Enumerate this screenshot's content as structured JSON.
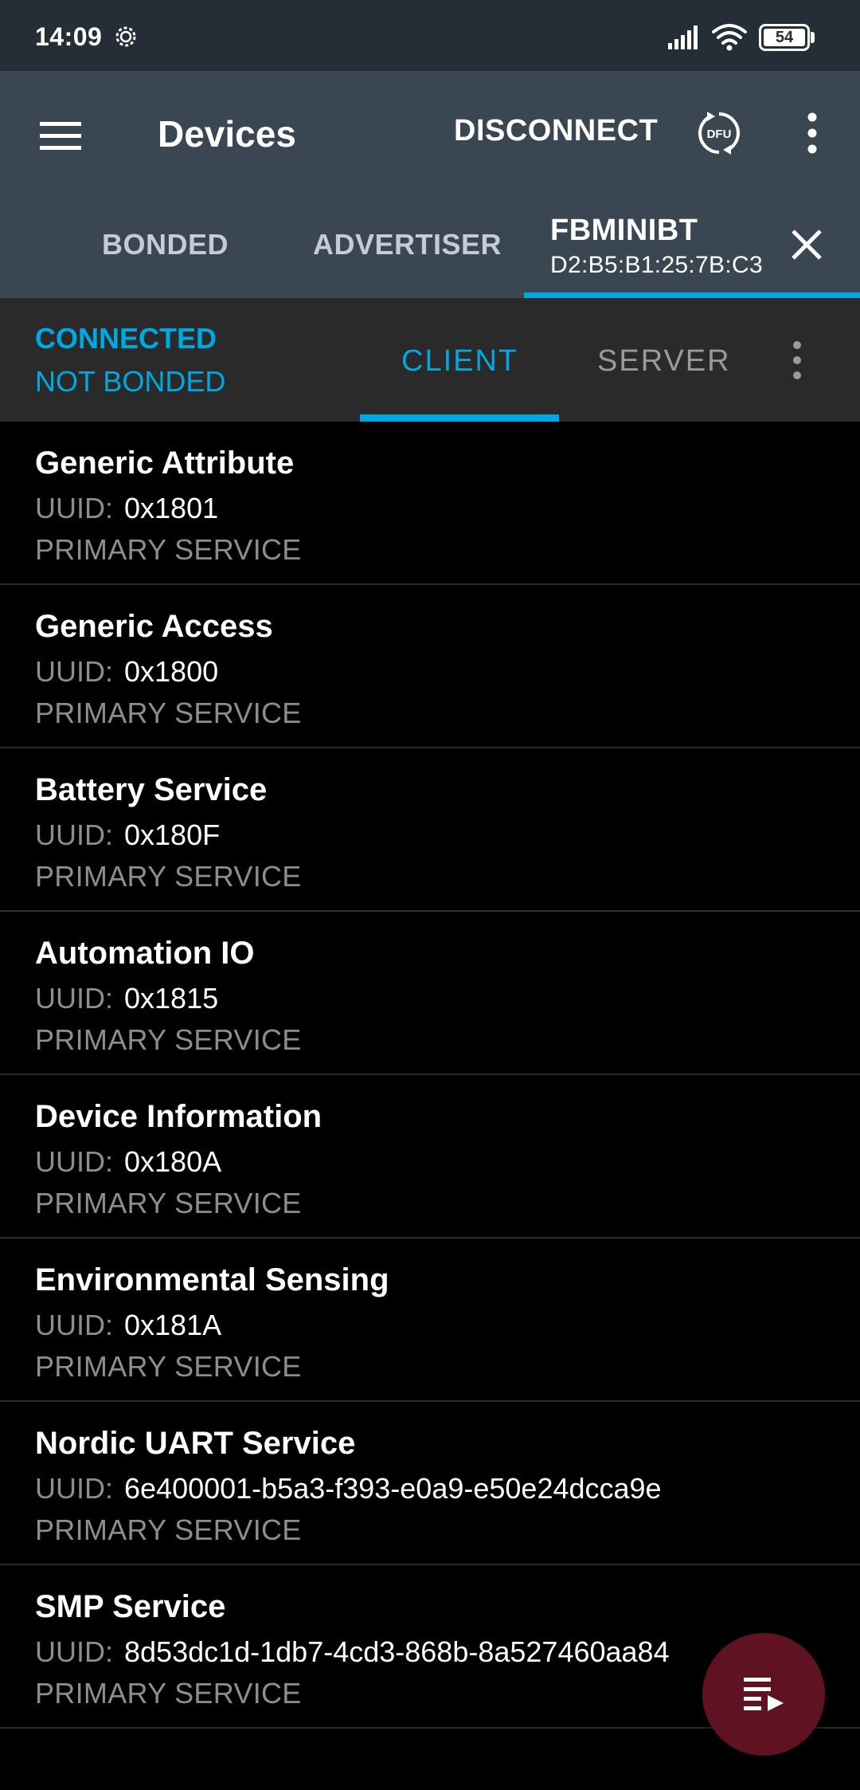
{
  "status_bar": {
    "time": "14:09",
    "battery_level": "54",
    "icons": [
      "settings-gear-icon",
      "cell-signal-icon",
      "wifi-icon",
      "battery-icon"
    ]
  },
  "app_bar": {
    "title": "Devices",
    "disconnect_label": "DISCONNECT",
    "dfu_label": "DFU"
  },
  "device_tabs": {
    "bonded": "BONDED",
    "advertiser": "ADVERTISER",
    "device_name": "FBMINIBT",
    "device_mac": "D2:B5:B1:25:7B:C3"
  },
  "connection": {
    "state": "CONNECTED",
    "bond_state": "NOT BONDED",
    "client_tab": "CLIENT",
    "server_tab": "SERVER"
  },
  "colors": {
    "accent": "#00a8e1",
    "app_bar": "#3a4753",
    "status_bar": "#252d36",
    "fab": "#5f1322"
  },
  "services": [
    {
      "name": "Generic Attribute",
      "uuid_label": "UUID:",
      "uuid": "0x1801",
      "type": "PRIMARY SERVICE"
    },
    {
      "name": "Generic Access",
      "uuid_label": "UUID:",
      "uuid": "0x1800",
      "type": "PRIMARY SERVICE"
    },
    {
      "name": "Battery Service",
      "uuid_label": "UUID:",
      "uuid": "0x180F",
      "type": "PRIMARY SERVICE"
    },
    {
      "name": "Automation IO",
      "uuid_label": "UUID:",
      "uuid": "0x1815",
      "type": "PRIMARY SERVICE"
    },
    {
      "name": "Device Information",
      "uuid_label": "UUID:",
      "uuid": "0x180A",
      "type": "PRIMARY SERVICE"
    },
    {
      "name": "Environmental Sensing",
      "uuid_label": "UUID:",
      "uuid": "0x181A",
      "type": "PRIMARY SERVICE"
    },
    {
      "name": "Nordic UART Service",
      "uuid_label": "UUID:",
      "uuid": "6e400001-b5a3-f393-e0a9-e50e24dcca9e",
      "type": "PRIMARY SERVICE"
    },
    {
      "name": "SMP Service",
      "uuid_label": "UUID:",
      "uuid": "8d53dc1d-1db7-4cd3-868b-8a527460aa84",
      "type": "PRIMARY SERVICE"
    }
  ]
}
